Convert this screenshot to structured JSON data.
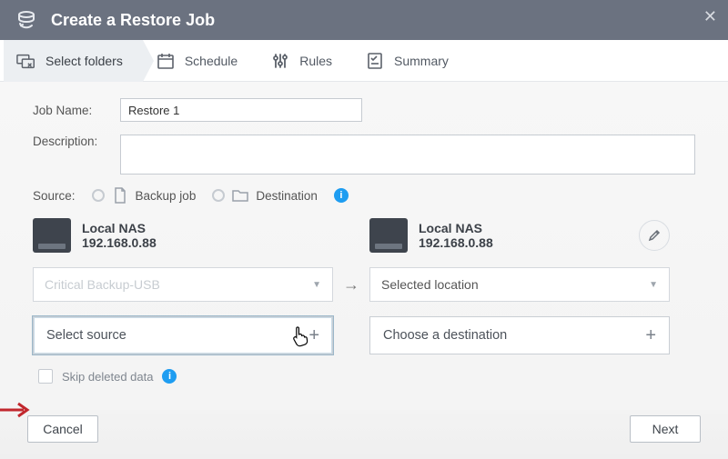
{
  "titlebar": {
    "title": "Create a Restore Job"
  },
  "steps": {
    "select_folders": "Select folders",
    "schedule": "Schedule",
    "rules": "Rules",
    "summary": "Summary"
  },
  "form": {
    "job_name_label": "Job Name:",
    "job_name_value": "Restore 1",
    "description_label": "Description:",
    "source_label": "Source:",
    "backup_job_label": "Backup job",
    "destination_label": "Destination",
    "skip_deleted_label": "Skip deleted data"
  },
  "nas": {
    "src_name": "Local NAS",
    "src_ip": "192.168.0.88",
    "dst_name": "Local NAS",
    "dst_ip": "192.168.0.88"
  },
  "selects": {
    "src_backup_placeholder": "Critical Backup-USB",
    "dst_location_value": "Selected location",
    "select_source": "Select source",
    "choose_destination": "Choose a destination"
  },
  "footer": {
    "cancel": "Cancel",
    "next": "Next"
  }
}
